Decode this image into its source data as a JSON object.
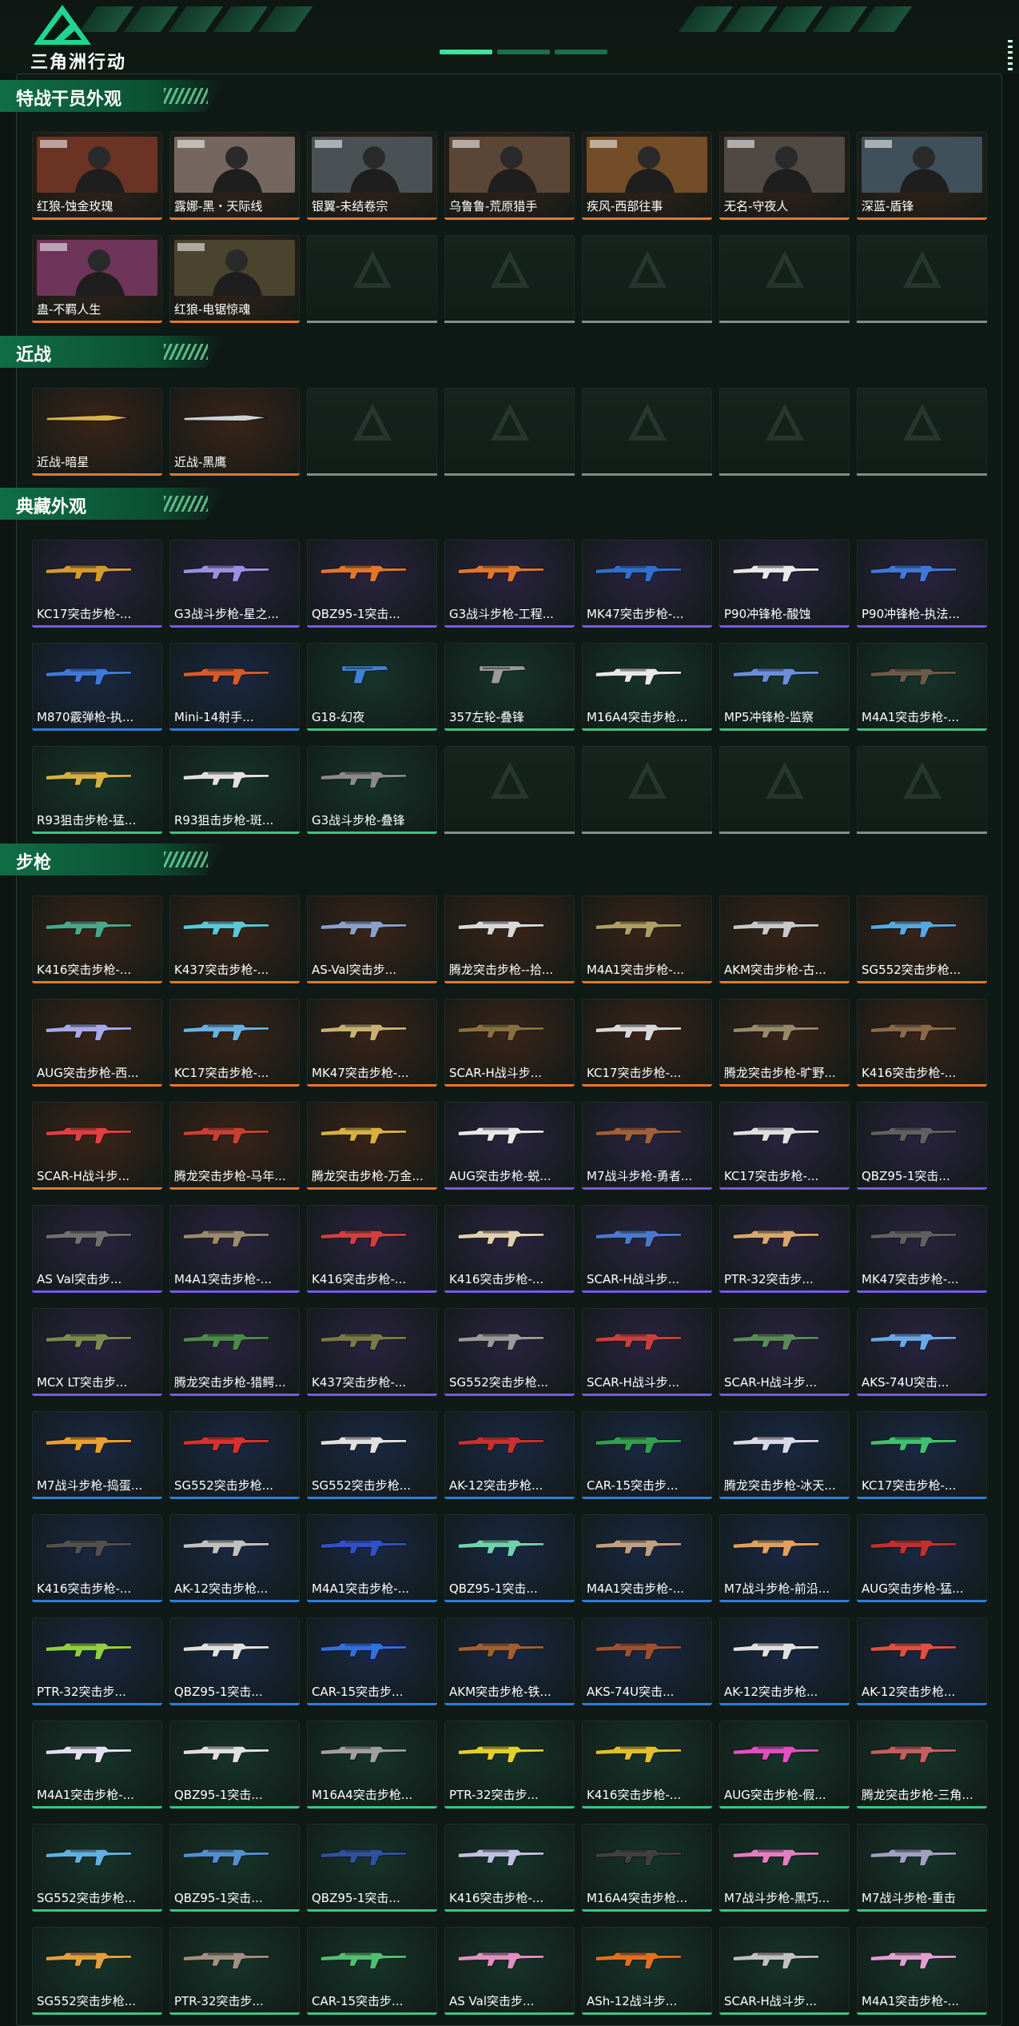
{
  "header": {
    "brand": "三角洲行动"
  },
  "palette": {
    "orange": {
      "bg": "#3a2418",
      "bar": "#e8762a"
    },
    "purple": {
      "bg": "#2a2340",
      "bar": "#7a59e6"
    },
    "blue": {
      "bg": "#1a2844",
      "bar": "#2f7de0"
    },
    "green": {
      "bg": "#16352a",
      "bar": "#3bc583"
    },
    "gold": {
      "bg": "#3a2b12",
      "bar": "#e2b23a"
    }
  },
  "sections": [
    {
      "title": "特战干员外观",
      "items": [
        {
          "label": "红狼-蚀金玫瑰",
          "rarity": "orange",
          "kind": "portrait",
          "accent": "#c6513a"
        },
        {
          "label": "露娜-黑・天际线",
          "rarity": "orange",
          "kind": "portrait",
          "accent": "#e6e6e6"
        },
        {
          "label": "银翼-未结卷宗",
          "rarity": "orange",
          "kind": "portrait",
          "accent": "#6aa5c8"
        },
        {
          "label": "乌鲁鲁-荒原猎手",
          "rarity": "orange",
          "kind": "portrait",
          "accent": "#9b8870"
        },
        {
          "label": "疾风-西部往事",
          "rarity": "orange",
          "kind": "portrait",
          "accent": "#e09a45"
        },
        {
          "label": "无名-守夜人",
          "rarity": "orange",
          "kind": "portrait",
          "accent": "#7a8d96"
        },
        {
          "label": "深蓝-盾锋",
          "rarity": "orange",
          "kind": "portrait",
          "accent": "#4aa3d6"
        },
        {
          "label": "蛊-不羁人生",
          "rarity": "orange",
          "kind": "portrait",
          "accent": "#d052d4"
        },
        {
          "label": "红狼-电锯惊魂",
          "rarity": "orange",
          "kind": "portrait",
          "accent": "#6a7d5a"
        }
      ],
      "slots": 14
    },
    {
      "title": "近战",
      "items": [
        {
          "label": "近战-暗星",
          "rarity": "orange",
          "kind": "knife",
          "accent": "#d9b24a"
        },
        {
          "label": "近战-黑鹰",
          "rarity": "orange",
          "kind": "knife",
          "accent": "#cfd2d4"
        }
      ],
      "slots": 7
    },
    {
      "title": "典藏外观",
      "items": [
        {
          "label": "KC17突击步枪-...",
          "rarity": "purple",
          "kind": "gun",
          "accent": "#d49a30"
        },
        {
          "label": "G3战斗步枪-星之...",
          "rarity": "purple",
          "kind": "gun",
          "accent": "#9a8fe0"
        },
        {
          "label": "QBZ95-1突击...",
          "rarity": "purple",
          "kind": "gun",
          "accent": "#e2762c"
        },
        {
          "label": "G3战斗步枪-工程...",
          "rarity": "purple",
          "kind": "gun",
          "accent": "#e2762c"
        },
        {
          "label": "MK47突击步枪-...",
          "rarity": "purple",
          "kind": "gun",
          "accent": "#2f6fd0"
        },
        {
          "label": "P90冲锋枪-酸蚀",
          "rarity": "purple",
          "kind": "gun",
          "accent": "#e8e8e8"
        },
        {
          "label": "P90冲锋枪-执法...",
          "rarity": "purple",
          "kind": "gun",
          "accent": "#3f78d8"
        },
        {
          "label": "M870霰弹枪-执...",
          "rarity": "blue",
          "kind": "gun",
          "accent": "#3f78d8"
        },
        {
          "label": "Mini-14射手...",
          "rarity": "blue",
          "kind": "gun",
          "accent": "#d65a2c"
        },
        {
          "label": "G18-幻夜",
          "rarity": "green",
          "kind": "pistol",
          "accent": "#3d82d8"
        },
        {
          "label": "357左轮-叠锋",
          "rarity": "green",
          "kind": "pistol",
          "accent": "#9a9a9a"
        },
        {
          "label": "M16A4突击步枪...",
          "rarity": "green",
          "kind": "gun",
          "accent": "#e8e8e8"
        },
        {
          "label": "MP5冲锋枪-监察",
          "rarity": "green",
          "kind": "gun",
          "accent": "#6a8fd8"
        },
        {
          "label": "M4A1突击步枪-...",
          "rarity": "green",
          "kind": "gun",
          "accent": "#6a5a48"
        },
        {
          "label": "R93狙击步枪-猛...",
          "rarity": "green",
          "kind": "gun",
          "accent": "#d6b040"
        },
        {
          "label": "R93狙击步枪-斑...",
          "rarity": "green",
          "kind": "gun",
          "accent": "#e0e0e0"
        },
        {
          "label": "G3战斗步枪-叠锋",
          "rarity": "green",
          "kind": "gun",
          "accent": "#8a8a8a"
        }
      ],
      "slots": 21
    },
    {
      "title": "步枪",
      "items": [
        {
          "label": "K416突击步枪-...",
          "rarity": "orange",
          "kind": "gun",
          "accent": "#4aa88a"
        },
        {
          "label": "K437突击步枪-...",
          "rarity": "orange",
          "kind": "gun",
          "accent": "#5ac8d8"
        },
        {
          "label": "AS-Val突击步...",
          "rarity": "orange",
          "kind": "gun",
          "accent": "#8aa0c8"
        },
        {
          "label": "腾龙突击步枪--拾...",
          "rarity": "orange",
          "kind": "gun",
          "accent": "#d8d8d8"
        },
        {
          "label": "M4A1突击步枪-...",
          "rarity": "orange",
          "kind": "gun",
          "accent": "#b0a060"
        },
        {
          "label": "AKM突击步枪-古...",
          "rarity": "orange",
          "kind": "gun",
          "accent": "#c8c8c8"
        },
        {
          "label": "SG552突击步枪...",
          "rarity": "orange",
          "kind": "gun",
          "accent": "#58a8e0"
        },
        {
          "label": "AUG突击步枪-西...",
          "rarity": "orange",
          "kind": "gun",
          "accent": "#a8a8e8"
        },
        {
          "label": "KC17突击步枪-...",
          "rarity": "orange",
          "kind": "gun",
          "accent": "#6ab0e0"
        },
        {
          "label": "MK47突击步枪-...",
          "rarity": "orange",
          "kind": "gun",
          "accent": "#c8b070"
        },
        {
          "label": "SCAR-H战斗步...",
          "rarity": "orange",
          "kind": "gun",
          "accent": "#8a7040"
        },
        {
          "label": "KC17突击步枪-...",
          "rarity": "orange",
          "kind": "gun",
          "accent": "#d8d8d8"
        },
        {
          "label": "腾龙突击步枪-旷野...",
          "rarity": "orange",
          "kind": "gun",
          "accent": "#9a8a6a"
        },
        {
          "label": "K416突击步枪-...",
          "rarity": "orange",
          "kind": "gun",
          "accent": "#8a6a48"
        },
        {
          "label": "SCAR-H战斗步...",
          "rarity": "orange",
          "kind": "gun",
          "accent": "#e04040"
        },
        {
          "label": "腾龙突击步枪-马年...",
          "rarity": "orange",
          "kind": "gun",
          "accent": "#c84030"
        },
        {
          "label": "腾龙突击步枪-万金...",
          "rarity": "orange",
          "kind": "gun",
          "accent": "#d8b040"
        },
        {
          "label": "AUG突击步枪-蜕...",
          "rarity": "purple",
          "kind": "gun",
          "accent": "#e8e8e8"
        },
        {
          "label": "M7战斗步枪-勇者...",
          "rarity": "purple",
          "kind": "gun",
          "accent": "#a0603a"
        },
        {
          "label": "KC17突击步枪-...",
          "rarity": "purple",
          "kind": "gun",
          "accent": "#e0e0e0"
        },
        {
          "label": "QBZ95-1突击...",
          "rarity": "purple",
          "kind": "gun",
          "accent": "#606060"
        },
        {
          "label": "AS Val突击步...",
          "rarity": "purple",
          "kind": "gun",
          "accent": "#707070"
        },
        {
          "label": "M4A1突击步枪-...",
          "rarity": "purple",
          "kind": "gun",
          "accent": "#9a8a70"
        },
        {
          "label": "K416突击步枪-...",
          "rarity": "purple",
          "kind": "gun",
          "accent": "#d04040"
        },
        {
          "label": "K416突击步枪-...",
          "rarity": "purple",
          "kind": "gun",
          "accent": "#e0d0b0"
        },
        {
          "label": "SCAR-H战斗步...",
          "rarity": "purple",
          "kind": "gun",
          "accent": "#4a7ad0"
        },
        {
          "label": "PTR-32突击步...",
          "rarity": "purple",
          "kind": "gun",
          "accent": "#d8a870"
        },
        {
          "label": "MK47突击步枪-...",
          "rarity": "purple",
          "kind": "gun",
          "accent": "#606060"
        },
        {
          "label": "MCX LT突击步...",
          "rarity": "purple",
          "kind": "gun",
          "accent": "#7a8a50"
        },
        {
          "label": "腾龙突击步枪-猎鳄...",
          "rarity": "purple",
          "kind": "gun",
          "accent": "#4a8a4a"
        },
        {
          "label": "K437突击步枪-...",
          "rarity": "purple",
          "kind": "gun",
          "accent": "#7a7a48"
        },
        {
          "label": "SG552突击步枪...",
          "rarity": "purple",
          "kind": "gun",
          "accent": "#9a9a9a"
        },
        {
          "label": "SCAR-H战斗步...",
          "rarity": "purple",
          "kind": "gun",
          "accent": "#c84040"
        },
        {
          "label": "SCAR-H战斗步...",
          "rarity": "purple",
          "kind": "gun",
          "accent": "#5a8a5a"
        },
        {
          "label": "AKS-74U突击...",
          "rarity": "purple",
          "kind": "gun",
          "accent": "#6aa8e8"
        },
        {
          "label": "M7战斗步枪-捣蛋...",
          "rarity": "blue",
          "kind": "gun",
          "accent": "#e8a030"
        },
        {
          "label": "SG552突击步枪...",
          "rarity": "blue",
          "kind": "gun",
          "accent": "#d83030"
        },
        {
          "label": "SG552突击步枪...",
          "rarity": "blue",
          "kind": "gun",
          "accent": "#e0e0e0"
        },
        {
          "label": "AK-12突击步枪...",
          "rarity": "blue",
          "kind": "gun",
          "accent": "#c83030"
        },
        {
          "label": "CAR-15突击步...",
          "rarity": "blue",
          "kind": "gun",
          "accent": "#30a050"
        },
        {
          "label": "腾龙突击步枪-冰天...",
          "rarity": "blue",
          "kind": "gun",
          "accent": "#d8d8e8"
        },
        {
          "label": "KC17突击步枪-...",
          "rarity": "blue",
          "kind": "gun",
          "accent": "#40c070"
        },
        {
          "label": "K416突击步枪-...",
          "rarity": "blue",
          "kind": "gun",
          "accent": "#505050"
        },
        {
          "label": "AK-12突击步枪...",
          "rarity": "blue",
          "kind": "gun",
          "accent": "#c0c0c0"
        },
        {
          "label": "M4A1突击步枪-...",
          "rarity": "blue",
          "kind": "gun",
          "accent": "#3050c8"
        },
        {
          "label": "QBZ95-1突击...",
          "rarity": "blue",
          "kind": "gun",
          "accent": "#70d0b0"
        },
        {
          "label": "M4A1突击步枪-...",
          "rarity": "blue",
          "kind": "gun",
          "accent": "#c0a080"
        },
        {
          "label": "M7战斗步枪-前沿...",
          "rarity": "blue",
          "kind": "gun",
          "accent": "#e0a060"
        },
        {
          "label": "AUG突击步枪-猛...",
          "rarity": "blue",
          "kind": "gun",
          "accent": "#c03030"
        },
        {
          "label": "PTR-32突击步...",
          "rarity": "blue",
          "kind": "gun",
          "accent": "#90d040"
        },
        {
          "label": "QBZ95-1突击...",
          "rarity": "blue",
          "kind": "gun",
          "accent": "#e0e0e0"
        },
        {
          "label": "CAR-15突击步...",
          "rarity": "blue",
          "kind": "gun",
          "accent": "#3070e0"
        },
        {
          "label": "AKM突击步枪-铁...",
          "rarity": "blue",
          "kind": "gun",
          "accent": "#a06030"
        },
        {
          "label": "AKS-74U突击...",
          "rarity": "blue",
          "kind": "gun",
          "accent": "#a05030"
        },
        {
          "label": "AK-12突击步枪...",
          "rarity": "blue",
          "kind": "gun",
          "accent": "#e0e0e0"
        },
        {
          "label": "AK-12突击步枪...",
          "rarity": "blue",
          "kind": "gun",
          "accent": "#e05040"
        },
        {
          "label": "M4A1突击步枪-...",
          "rarity": "green",
          "kind": "gun",
          "accent": "#e0e0f0"
        },
        {
          "label": "QBZ95-1突击...",
          "rarity": "green",
          "kind": "gun",
          "accent": "#e0e0e0"
        },
        {
          "label": "M16A4突击步枪...",
          "rarity": "green",
          "kind": "gun",
          "accent": "#a0a0a0"
        },
        {
          "label": "PTR-32突击步...",
          "rarity": "green",
          "kind": "gun",
          "accent": "#e0d030"
        },
        {
          "label": "K416突击步枪-...",
          "rarity": "green",
          "kind": "gun",
          "accent": "#e0c030"
        },
        {
          "label": "AUG突击步枪-假...",
          "rarity": "green",
          "kind": "gun",
          "accent": "#e050c0"
        },
        {
          "label": "腾龙突击步枪-三角...",
          "rarity": "green",
          "kind": "gun",
          "accent": "#c06060"
        },
        {
          "label": "SG552突击步枪...",
          "rarity": "green",
          "kind": "gun",
          "accent": "#60b0e0"
        },
        {
          "label": "QBZ95-1突击...",
          "rarity": "green",
          "kind": "gun",
          "accent": "#5090d0"
        },
        {
          "label": "QBZ95-1突击...",
          "rarity": "green",
          "kind": "gun",
          "accent": "#3050a0"
        },
        {
          "label": "K416突击步枪-...",
          "rarity": "green",
          "kind": "gun",
          "accent": "#c0c0e0"
        },
        {
          "label": "M16A4突击步枪...",
          "rarity": "green",
          "kind": "gun",
          "accent": "#404040"
        },
        {
          "label": "M7战斗步枪-黑巧...",
          "rarity": "green",
          "kind": "gun",
          "accent": "#e080c0"
        },
        {
          "label": "M7战斗步枪-重击",
          "rarity": "green",
          "kind": "gun",
          "accent": "#a0a0c0"
        },
        {
          "label": "SG552突击步枪...",
          "rarity": "green",
          "kind": "gun",
          "accent": "#e0a040"
        },
        {
          "label": "PTR-32突击步...",
          "rarity": "green",
          "kind": "gun",
          "accent": "#a09080"
        },
        {
          "label": "CAR-15突击步...",
          "rarity": "green",
          "kind": "gun",
          "accent": "#50c070"
        },
        {
          "label": "AS Val突击步...",
          "rarity": "green",
          "kind": "gun",
          "accent": "#e090c0"
        },
        {
          "label": "ASh-12战斗步...",
          "rarity": "green",
          "kind": "gun",
          "accent": "#e07020"
        },
        {
          "label": "SCAR-H战斗步...",
          "rarity": "green",
          "kind": "gun",
          "accent": "#c0c0c0"
        },
        {
          "label": "M4A1突击步枪-...",
          "rarity": "green",
          "kind": "gun",
          "accent": "#e0a0d0"
        }
      ],
      "slots": 77
    }
  ]
}
